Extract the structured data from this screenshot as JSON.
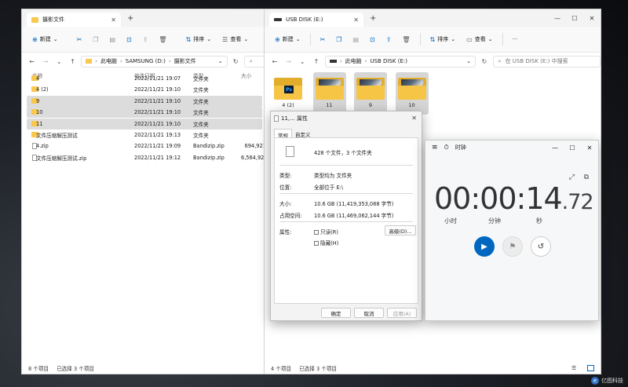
{
  "left_explorer": {
    "tab_title": "摄影文件",
    "toolbar": {
      "new": "新建",
      "sort": "排序",
      "view": "查看",
      "more": "···"
    },
    "breadcrumb": [
      "此电脑",
      "SAMSUNG (D:)",
      "摄影文件"
    ],
    "columns": [
      "名称",
      "修改日期",
      "类型",
      "大小"
    ],
    "rows": [
      {
        "name": "4",
        "date": "2022/11/21 19:07",
        "type": "文件夹",
        "size": "",
        "kind": "folder",
        "selected": false
      },
      {
        "name": "4 (2)",
        "date": "2022/11/21 19:10",
        "type": "文件夹",
        "size": "",
        "kind": "folder",
        "selected": false
      },
      {
        "name": "9",
        "date": "2022/11/21 19:10",
        "type": "文件夹",
        "size": "",
        "kind": "folder",
        "selected": true
      },
      {
        "name": "10",
        "date": "2022/11/21 19:10",
        "type": "文件夹",
        "size": "",
        "kind": "folder",
        "selected": true
      },
      {
        "name": "11",
        "date": "2022/11/21 19:10",
        "type": "文件夹",
        "size": "",
        "kind": "folder",
        "selected": true
      },
      {
        "name": "文件压缩解压测试",
        "date": "2022/11/21 19:13",
        "type": "文件夹",
        "size": "",
        "kind": "folder",
        "selected": false
      },
      {
        "name": "4.zip",
        "date": "2022/11/21 19:09",
        "type": "Bandizip.zip",
        "size": "694,921,",
        "kind": "file",
        "selected": false
      },
      {
        "name": "文件压缩解压测试.zip",
        "date": "2022/11/21 19:12",
        "type": "Bandizip.zip",
        "size": "6,564,929,",
        "kind": "file",
        "selected": false
      }
    ],
    "status": {
      "count": "8 个项目",
      "selected": "已选择 3 个项目"
    }
  },
  "right_explorer": {
    "tab_title": "USB DISK (E:)",
    "toolbar": {
      "new": "新建",
      "sort": "排序",
      "view": "查看",
      "more": "···"
    },
    "breadcrumb": [
      "此电脑",
      "USB DISK (E:)"
    ],
    "search_placeholder": "在 USB DISK (E:) 中搜索",
    "items": [
      {
        "name": "4 (2)",
        "ps": true,
        "selected": false
      },
      {
        "name": "11",
        "ps": false,
        "selected": true
      },
      {
        "name": "9",
        "ps": false,
        "selected": true
      },
      {
        "name": "10",
        "ps": false,
        "selected": true
      }
    ],
    "status": {
      "count": "4 个项目",
      "selected": "已选择 3 个项目"
    }
  },
  "properties": {
    "title": "11,... 属性",
    "tabs": [
      "常规",
      "自定义"
    ],
    "summary": "428 个文件，3 个文件夹",
    "type_label": "类型:",
    "type_value": "类型均为 文件夹",
    "location_label": "位置:",
    "location_value": "全部位于 E:\\",
    "size_label": "大小:",
    "size_value": "10.6 GB (11,419,353,088 字节)",
    "ondisk_label": "占用空间:",
    "ondisk_value": "10.6 GB (11,469,062,144 字节)",
    "attr_label": "属性:",
    "readonly": "只读(R)",
    "hidden": "隐藏(H)",
    "advanced": "高级(D)...",
    "ok": "确定",
    "cancel": "取消",
    "apply": "应用(A)"
  },
  "clock": {
    "title": "时钟",
    "time": "00:00:14",
    "ms": ".72",
    "units": {
      "h": "小时",
      "m": "分钟",
      "s": "秒"
    }
  },
  "watermark": "亿图科技"
}
